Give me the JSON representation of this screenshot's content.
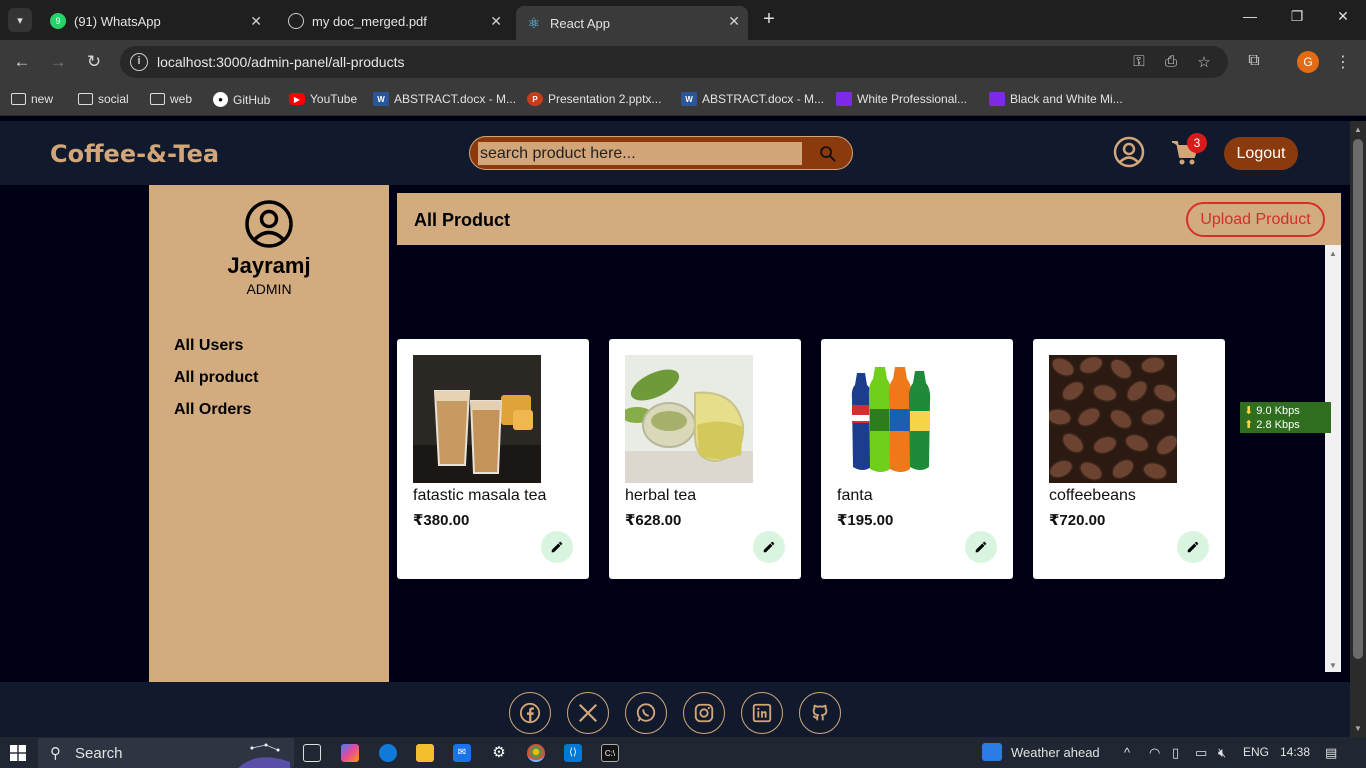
{
  "browser": {
    "tabs": [
      {
        "title": "(91) WhatsApp",
        "favicon": "whatsapp-icon",
        "badge": "91"
      },
      {
        "title": "my doc_merged.pdf",
        "favicon": "globe-icon"
      },
      {
        "title": "React App",
        "favicon": "react-icon",
        "active": true
      }
    ],
    "url": "localhost:3000/admin-panel/all-products",
    "profile_initial": "G",
    "bookmarks": [
      {
        "label": "new",
        "icon": "folder-icon"
      },
      {
        "label": "social",
        "icon": "folder-icon"
      },
      {
        "label": "web",
        "icon": "folder-icon"
      },
      {
        "label": "GitHub",
        "icon": "github-icon"
      },
      {
        "label": "YouTube",
        "icon": "youtube-icon"
      },
      {
        "label": "ABSTRACT.docx - M...",
        "icon": "word-icon"
      },
      {
        "label": "Presentation 2.pptx...",
        "icon": "powerpoint-icon"
      },
      {
        "label": "ABSTRACT.docx - M...",
        "icon": "word-icon"
      },
      {
        "label": "White Professional...",
        "icon": "canva-icon"
      },
      {
        "label": "Black and White Mi...",
        "icon": "canva-icon"
      }
    ]
  },
  "header": {
    "logo": "Coffee-&-Tea",
    "search_placeholder": "search product here...",
    "cart_count": "3",
    "logout_label": "Logout"
  },
  "sidebar": {
    "name": "Jayramj",
    "role": "ADMIN",
    "links": [
      "All Users",
      "All product",
      "All Orders"
    ]
  },
  "main": {
    "title": "All Product",
    "upload_label": "Upload Product",
    "products": [
      {
        "name": "fatastic masala tea",
        "price": "₹380.00"
      },
      {
        "name": "herbal tea",
        "price": "₹628.00"
      },
      {
        "name": "fanta",
        "price": "₹195.00"
      },
      {
        "name": "coffeebeans",
        "price": "₹720.00"
      }
    ]
  },
  "net_meter": {
    "down": "9.0 Kbps",
    "up": "2.8 Kbps"
  },
  "footer": {
    "social_icons": [
      "facebook-icon",
      "x-icon",
      "whatsapp-icon",
      "instagram-icon",
      "linkedin-icon",
      "github-icon"
    ]
  },
  "taskbar": {
    "search_label": "Search",
    "weather": "Weather ahead",
    "language": "ENG",
    "time": "14:38"
  },
  "colors": {
    "accent_tan": "#d2ab7e",
    "brand_brown": "#8b3a0e",
    "header_navy": "#111a2c",
    "page_bg": "#000015",
    "upload_red": "#d32f2f",
    "cart_badge": "#d71b1b"
  }
}
